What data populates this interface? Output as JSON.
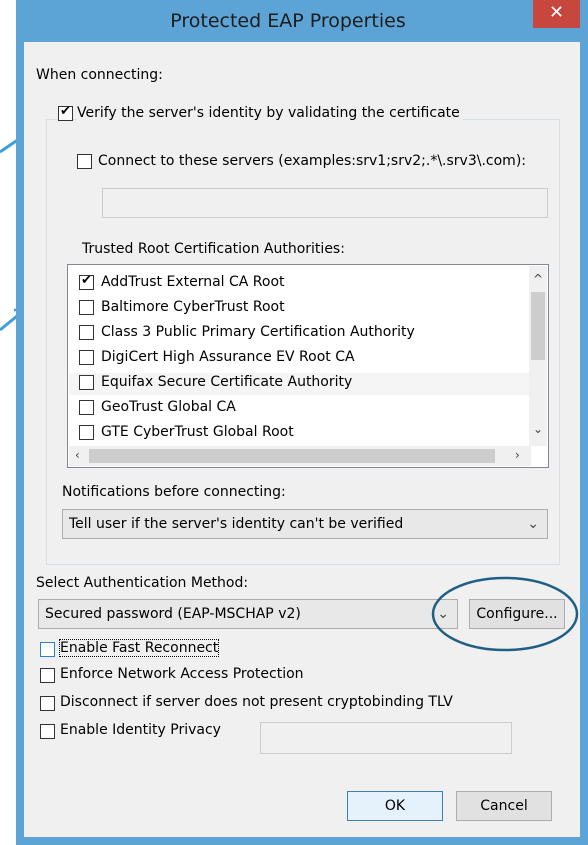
{
  "window": {
    "title": "Protected EAP Properties",
    "close_glyph": "✕"
  },
  "when_connecting_label": "When connecting:",
  "verify_server": {
    "label": "Verify the server's identity by validating the certificate",
    "checked": true
  },
  "connect_servers": {
    "label": "Connect to these servers (examples:srv1;srv2;.*\\.srv3\\.com):",
    "checked": false,
    "value": ""
  },
  "trusted_root_label": "Trusted Root Certification Authorities:",
  "certificates": [
    {
      "name": "AddTrust External CA Root",
      "checked": true
    },
    {
      "name": "Baltimore CyberTrust Root",
      "checked": false
    },
    {
      "name": "Class 3 Public Primary Certification Authority",
      "checked": false
    },
    {
      "name": "DigiCert High Assurance EV Root CA",
      "checked": false
    },
    {
      "name": "Equifax Secure Certificate Authority",
      "checked": false
    },
    {
      "name": "GeoTrust Global CA",
      "checked": false
    },
    {
      "name": "GTE CyberTrust Global Root",
      "checked": false
    }
  ],
  "notifications_label": "Notifications before connecting:",
  "notifications_value": "Tell user if the server's identity can't be verified",
  "auth_method_label": "Select Authentication Method:",
  "auth_method_value": "Secured password (EAP-MSCHAP v2)",
  "configure_label": "Configure...",
  "options": [
    {
      "label": "Enable Fast Reconnect",
      "checked": false
    },
    {
      "label": "Enforce Network Access Protection",
      "checked": false
    },
    {
      "label": "Disconnect if server does not present cryptobinding TLV",
      "checked": false
    },
    {
      "label": "Enable Identity Privacy",
      "checked": false
    }
  ],
  "identity_privacy_value": "",
  "ok_label": "OK",
  "cancel_label": "Cancel",
  "colors": {
    "title_bar": "#5da4d6",
    "close": "#c7463d",
    "annotation": "#1f5f86"
  }
}
